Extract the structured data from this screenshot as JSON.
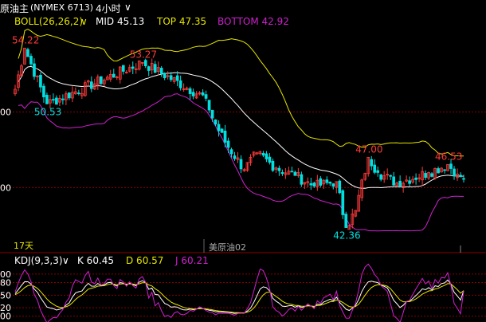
{
  "header": {
    "instrument": "原油主",
    "exchange_code": "(NYMEX 6713)",
    "period": "4小时",
    "period_arrow": "∨"
  },
  "boll_legend": {
    "label": "BOLL(26,26,2)",
    "arrow": "∨",
    "mid": "MID 45.13",
    "top": "TOP 47.35",
    "bottom": "BOTTOM 42.92"
  },
  "kdj_legend": {
    "label": "KDJ(9,3,3)",
    "arrow": "∨",
    "k": "K 60.45",
    "d": "D 60.57",
    "j": "J 60.21"
  },
  "bottom_labels": {
    "left": "17天",
    "watermark": "美原油02"
  },
  "colors": {
    "background": "#000000",
    "up": "#ff3b3b",
    "down": "#00e0e0",
    "mid": "#ffffff",
    "top": "#e6e600",
    "bottom": "#d020d0",
    "k": "#ffffff",
    "d": "#e6e600",
    "j": "#d020d0",
    "grid": "#8b0000"
  },
  "chart_data": [
    {
      "type": "candlestick",
      "indicator": "BOLL(26,26,2)",
      "y_axis_ticks": [
        {
          "value": 50,
          "label": "00"
        },
        {
          "value": 45,
          "label": "00"
        }
      ],
      "ylim": [
        41.6,
        55.5
      ],
      "annotations": [
        {
          "label": "54.22",
          "value": 54.22,
          "kind": "high"
        },
        {
          "label": "50.53",
          "value": 50.53,
          "kind": "low"
        },
        {
          "label": "53.27",
          "value": 53.27,
          "kind": "high"
        },
        {
          "label": "47.00",
          "value": 47.0,
          "kind": "high"
        },
        {
          "label": "46.53",
          "value": 46.53,
          "kind": "high"
        },
        {
          "label": "42.36",
          "value": 42.36,
          "kind": "low"
        }
      ],
      "last": {
        "mid": 45.13,
        "top": 47.35,
        "bottom": 42.92
      },
      "key_points": [
        {
          "i": 0,
          "value": 51.5
        },
        {
          "i": 3,
          "value": 54.22
        },
        {
          "i": 10,
          "value": 50.53
        },
        {
          "i": 40,
          "value": 53.27
        },
        {
          "i": 60,
          "value": 50.9
        },
        {
          "i": 62,
          "value": 49.6
        },
        {
          "i": 66,
          "value": 48.0
        },
        {
          "i": 72,
          "value": 46.2
        },
        {
          "i": 76,
          "value": 47.3
        },
        {
          "i": 82,
          "value": 46.3
        },
        {
          "i": 88,
          "value": 45.8
        },
        {
          "i": 94,
          "value": 45.1
        },
        {
          "i": 101,
          "value": 45.4
        },
        {
          "i": 104,
          "value": 42.36
        },
        {
          "i": 107,
          "value": 43.5
        },
        {
          "i": 111,
          "value": 47.0
        },
        {
          "i": 114,
          "value": 46.0
        },
        {
          "i": 120,
          "value": 45.3
        },
        {
          "i": 130,
          "value": 46.0
        },
        {
          "i": 136,
          "value": 46.53
        },
        {
          "i": 139,
          "value": 45.9
        },
        {
          "i": 141,
          "value": 45.6
        }
      ],
      "candle_count": 142
    },
    {
      "type": "line",
      "indicator": "KDJ(9,3,3)",
      "y_axis_ticks": [
        {
          "value": 100,
          "label": "00"
        },
        {
          "value": 80,
          "label": "80"
        },
        {
          "value": 50,
          "label": "50"
        },
        {
          "value": 20,
          "label": "20"
        },
        {
          "value": 0,
          "label": "00"
        }
      ],
      "ylim": [
        -10,
        115
      ],
      "series": [
        {
          "name": "K",
          "last": 60.45
        },
        {
          "name": "D",
          "last": 60.57
        },
        {
          "name": "J",
          "last": 60.21
        }
      ]
    }
  ]
}
